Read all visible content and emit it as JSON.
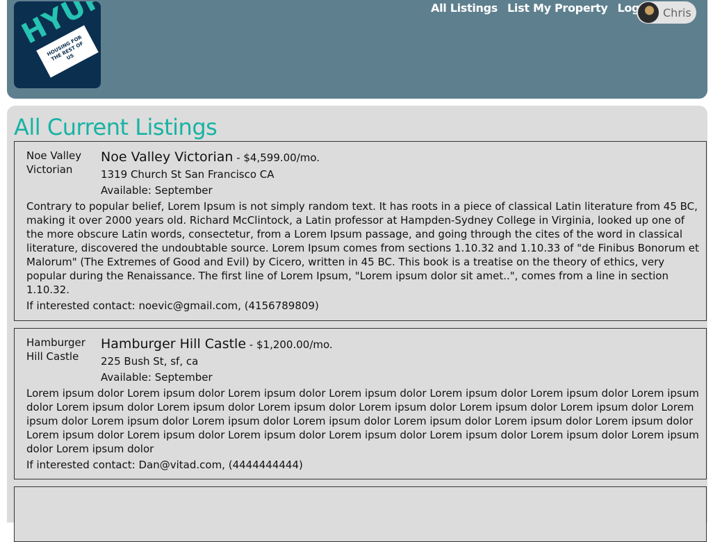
{
  "brand": {
    "logo_text": "HYUP",
    "logo_tagline": "HOUSING FOR THE REST OF US"
  },
  "nav": {
    "all_listings": "All Listings",
    "list_property": "List My Property",
    "logout": "Logout",
    "user_name": "Chris"
  },
  "page": {
    "title": "All Current Listings"
  },
  "listings": [
    {
      "image_alt": "Noe Valley Victorian",
      "title": "Noe Valley Victorian",
      "price": "- $4,599.00/mo.",
      "address": "1319 Church St San Francisco CA",
      "available_label": "Available:",
      "available_value": "September",
      "description": "Contrary to popular belief, Lorem Ipsum is not simply random text. It has roots in a piece of classical Latin literature from 45 BC, making it over 2000 years old. Richard McClintock, a Latin professor at Hampden-Sydney College in Virginia, looked up one of the more obscure Latin words, consectetur, from a Lorem Ipsum passage, and going through the cites of the word in classical literature, discovered the undoubtable source. Lorem Ipsum comes from sections 1.10.32 and 1.10.33 of \"de Finibus Bonorum et Malorum\" (The Extremes of Good and Evil) by Cicero, written in 45 BC. This book is a treatise on the theory of ethics, very popular during the Renaissance. The first line of Lorem Ipsum, \"Lorem ipsum dolor sit amet..\", comes from a line in section 1.10.32.",
      "contact": "If interested contact: noevic@gmail.com, (4156789809)"
    },
    {
      "image_alt": "Hamburger Hill Castle",
      "title": "Hamburger Hill Castle",
      "price": "- $1,200.00/mo.",
      "address": "225 Bush St, sf, ca",
      "available_label": "Available:",
      "available_value": "September",
      "description": "Lorem ipsum dolor Lorem ipsum dolor Lorem ipsum dolor Lorem ipsum dolor Lorem ipsum dolor Lorem ipsum dolor Lorem ipsum dolor Lorem ipsum dolor Lorem ipsum dolor Lorem ipsum dolor Lorem ipsum dolor Lorem ipsum dolor Lorem ipsum dolor Lorem ipsum dolor Lorem ipsum dolor Lorem ipsum dolor Lorem ipsum dolor Lorem ipsum dolor Lorem ipsum dolor Lorem ipsum dolor Lorem ipsum dolor Lorem ipsum dolor Lorem ipsum dolor Lorem ipsum dolor Lorem ipsum dolor Lorem ipsum dolor Lorem ipsum dolor Lorem ipsum dolor",
      "contact": "If interested contact: Dan@vitad.com, (4444444444)"
    }
  ],
  "colors": {
    "header_bg": "#5e7f8e",
    "content_bg": "#dcdcdc",
    "accent": "#17b3a3",
    "logo_bg": "#0b2f4f"
  }
}
